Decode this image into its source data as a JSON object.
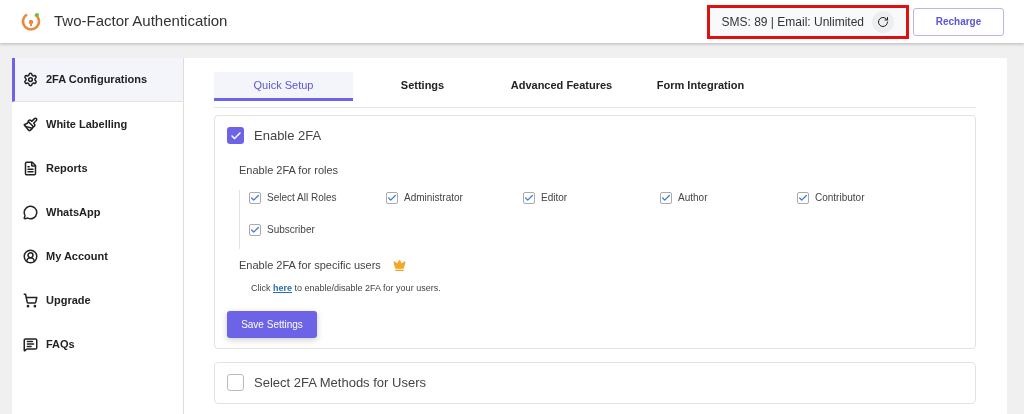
{
  "header": {
    "title": "Two-Factor Authentication",
    "credits": "SMS: 89 | Email: Unlimited",
    "highlighted": true,
    "recharge": "Recharge"
  },
  "sidebar": {
    "items": [
      {
        "label": "2FA Configurations",
        "selected": true
      },
      {
        "label": "White Labelling",
        "selected": false
      },
      {
        "label": "Reports",
        "selected": false
      },
      {
        "label": "WhatsApp",
        "selected": false
      },
      {
        "label": "My Account",
        "selected": false
      },
      {
        "label": "Upgrade",
        "selected": false
      },
      {
        "label": "FAQs",
        "selected": false
      }
    ]
  },
  "tabs": [
    {
      "label": "Quick Setup",
      "selected": true
    },
    {
      "label": "Settings",
      "selected": false
    },
    {
      "label": "Advanced Features",
      "selected": false
    },
    {
      "label": "Form Integration",
      "selected": false
    }
  ],
  "sections": [
    {
      "title": "Enable 2FA",
      "checked": true,
      "roles_label": "Enable 2FA for roles",
      "roles": [
        {
          "label": "Select All Roles",
          "checked": true
        },
        {
          "label": "Administrator",
          "checked": true
        },
        {
          "label": "Editor",
          "checked": true
        },
        {
          "label": "Author",
          "checked": true
        },
        {
          "label": "Contributor",
          "checked": true
        },
        {
          "label": "Subscriber",
          "checked": true
        }
      ],
      "users_label": "Enable 2FA for specific users",
      "users_premium": true,
      "users_text": {
        "before": "Click",
        "link": "here",
        "after": "to enable/disable 2FA for your users."
      },
      "save": "Save Settings"
    },
    {
      "title": "Select 2FA Methods for Users",
      "checked": false
    }
  ]
}
